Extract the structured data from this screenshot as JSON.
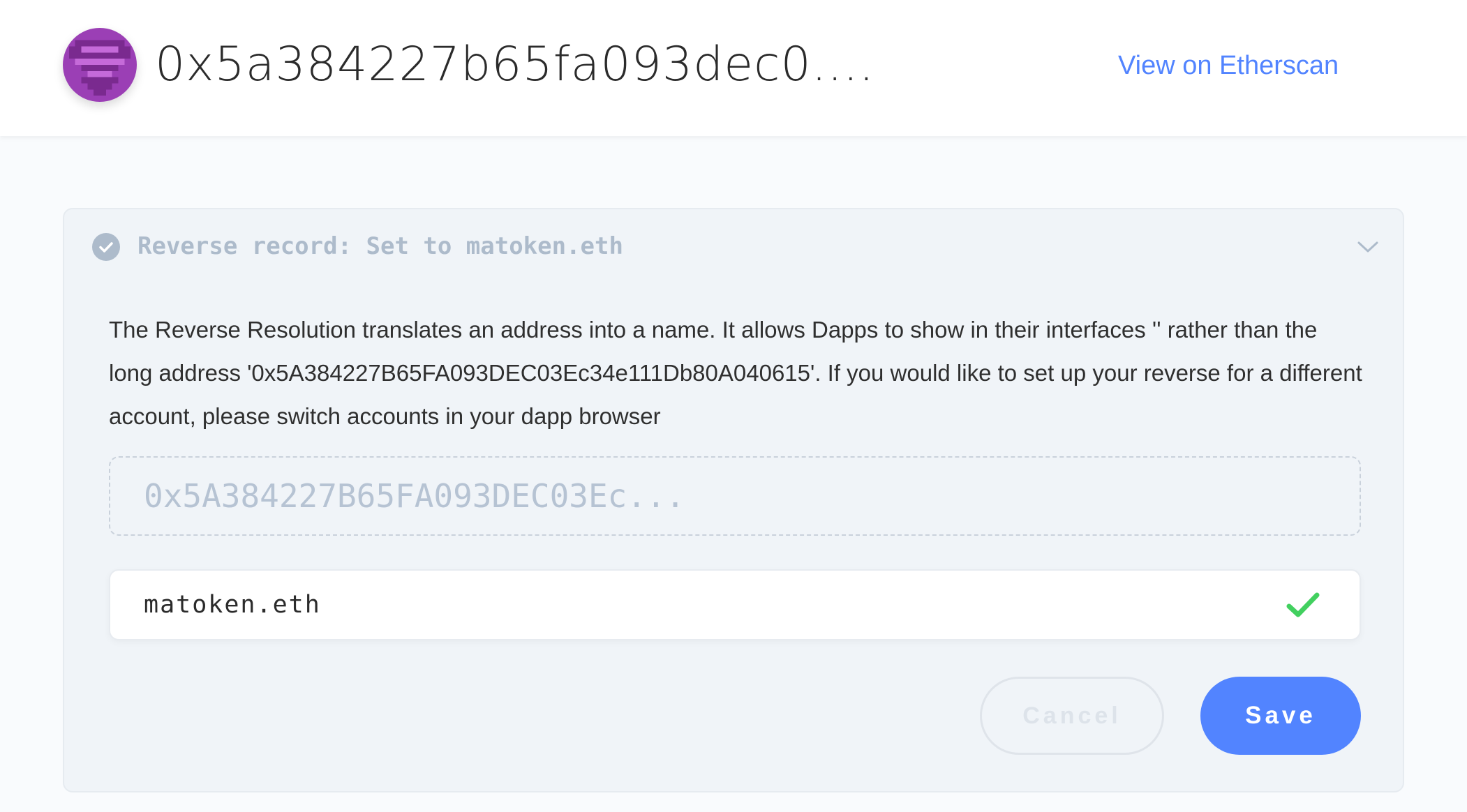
{
  "header": {
    "address": "0x5a384227b65fa093dec0....",
    "etherscan_link": "View on Etherscan",
    "avatar_icon": "identicon-avatar"
  },
  "record": {
    "status_icon": "check-circle-icon",
    "title": "Reverse record: Set to matoken.eth",
    "collapse_icon": "chevron-down-icon",
    "description": "The Reverse Resolution translates an address into a name. It allows Dapps to show in their interfaces '' rather than the long address '0x5A384227B65FA093DEC03Ec34e111Db80A040615'. If you would like to set up your reverse for a different account, please switch accounts in your dapp browser",
    "address_placeholder": "0x5A384227B65FA093DEC03Ec...",
    "name_value": "matoken.eth",
    "valid_icon": "checkmark-icon"
  },
  "actions": {
    "cancel_label": "Cancel",
    "save_label": "Save"
  },
  "colors": {
    "accent": "#5284ff",
    "success": "#42d05f",
    "muted": "#adbbcb",
    "avatar_purple": "#9b3fb5"
  }
}
